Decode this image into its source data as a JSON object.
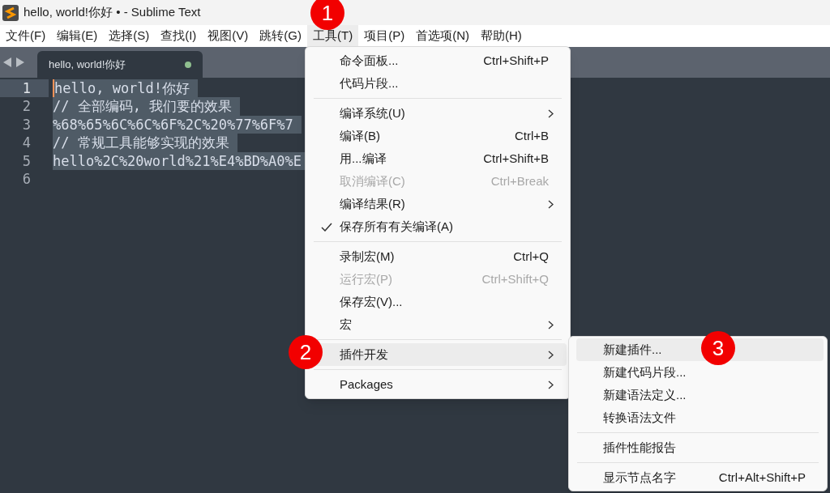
{
  "window": {
    "title": "hello, world!你好 • - Sublime Text"
  },
  "menubar": [
    {
      "label": "文件(F)",
      "selected": false
    },
    {
      "label": "编辑(E)",
      "selected": false
    },
    {
      "label": "选择(S)",
      "selected": false
    },
    {
      "label": "查找(I)",
      "selected": false
    },
    {
      "label": "视图(V)",
      "selected": false
    },
    {
      "label": "跳转(G)",
      "selected": false
    },
    {
      "label": "工具(T)",
      "selected": true
    },
    {
      "label": "项目(P)",
      "selected": false
    },
    {
      "label": "首选项(N)",
      "selected": false
    },
    {
      "label": "帮助(H)",
      "selected": false
    }
  ],
  "tabs": [
    {
      "label": "hello, world!你好",
      "selected": true,
      "modified": true
    }
  ],
  "editor": {
    "lines": [
      {
        "number": "1",
        "text": "hello, world!你好",
        "current": true
      },
      {
        "number": "2",
        "text": "// 全部编码, 我们要的效果",
        "current": false
      },
      {
        "number": "3",
        "text": "%68%65%6C%6C%6F%2C%20%77%6F%7",
        "current": false
      },
      {
        "number": "4",
        "text": "// 常规工具能够实现的效果",
        "current": false
      },
      {
        "number": "5",
        "text": "hello%2C%20world%21%E4%BD%A0%E",
        "current": false
      },
      {
        "number": "6",
        "current": false
      }
    ]
  },
  "tools_menu": [
    {
      "kind": "item",
      "label": "命令面板...",
      "shortcut": "Ctrl+Shift+P",
      "disabled": false,
      "checked": false,
      "submenu": false,
      "selected": false
    },
    {
      "kind": "item",
      "label": "代码片段...",
      "disabled": false,
      "checked": false,
      "submenu": false,
      "selected": false
    },
    {
      "kind": "separator"
    },
    {
      "kind": "item",
      "label": "编译系统(U)",
      "disabled": false,
      "checked": false,
      "submenu": true,
      "selected": false
    },
    {
      "kind": "item",
      "label": "编译(B)",
      "shortcut": "Ctrl+B",
      "disabled": false,
      "checked": false,
      "submenu": false,
      "selected": false
    },
    {
      "kind": "item",
      "label": "用...编译",
      "shortcut": "Ctrl+Shift+B",
      "disabled": false,
      "checked": false,
      "submenu": false,
      "selected": false
    },
    {
      "kind": "item",
      "label": "取消编译(C)",
      "shortcut": "Ctrl+Break",
      "disabled": true,
      "checked": false,
      "submenu": false,
      "selected": false
    },
    {
      "kind": "item",
      "label": "编译结果(R)",
      "disabled": false,
      "checked": false,
      "submenu": true,
      "selected": false
    },
    {
      "kind": "item",
      "label": "保存所有有关编译(A)",
      "disabled": false,
      "checked": true,
      "submenu": false,
      "selected": false
    },
    {
      "kind": "separator"
    },
    {
      "kind": "item",
      "label": "录制宏(M)",
      "shortcut": "Ctrl+Q",
      "disabled": false,
      "checked": false,
      "submenu": false,
      "selected": false
    },
    {
      "kind": "item",
      "label": "运行宏(P)",
      "shortcut": "Ctrl+Shift+Q",
      "disabled": true,
      "checked": false,
      "submenu": false,
      "selected": false
    },
    {
      "kind": "item",
      "label": "保存宏(V)...",
      "disabled": false,
      "checked": false,
      "submenu": false,
      "selected": false
    },
    {
      "kind": "item",
      "label": "宏",
      "disabled": false,
      "checked": false,
      "submenu": true,
      "selected": false
    },
    {
      "kind": "separator"
    },
    {
      "kind": "item",
      "label": "插件开发",
      "disabled": false,
      "checked": false,
      "submenu": true,
      "selected": true
    },
    {
      "kind": "separator"
    },
    {
      "kind": "item",
      "label": "Packages",
      "disabled": false,
      "checked": false,
      "submenu": true,
      "selected": false
    }
  ],
  "plugin_submenu": [
    {
      "kind": "item",
      "label": "新建插件...",
      "disabled": false,
      "checked": false,
      "submenu": false,
      "selected": true
    },
    {
      "kind": "item",
      "label": "新建代码片段...",
      "disabled": false,
      "checked": false,
      "submenu": false,
      "selected": false
    },
    {
      "kind": "item",
      "label": "新建语法定义...",
      "disabled": false,
      "checked": false,
      "submenu": false,
      "selected": false
    },
    {
      "kind": "item",
      "label": "转换语法文件",
      "disabled": false,
      "checked": false,
      "submenu": false,
      "selected": false
    },
    {
      "kind": "separator"
    },
    {
      "kind": "item",
      "label": "插件性能报告",
      "disabled": false,
      "checked": false,
      "submenu": false,
      "selected": false
    },
    {
      "kind": "separator"
    },
    {
      "kind": "item",
      "label": "显示节点名字",
      "shortcut": "Ctrl+Alt+Shift+P",
      "disabled": false,
      "checked": false,
      "submenu": false,
      "selected": false
    }
  ],
  "callouts": [
    {
      "label": "1"
    },
    {
      "label": "2"
    },
    {
      "label": "3"
    }
  ]
}
